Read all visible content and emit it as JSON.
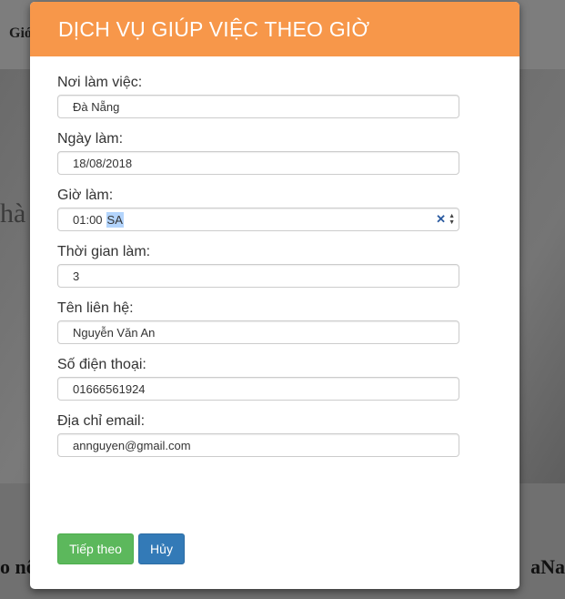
{
  "background": {
    "nav_text": "Giớ",
    "hero_text": "hà",
    "bottom_left": "o nổ",
    "bottom_right": "aNa"
  },
  "modal": {
    "title": "DỊCH VỤ GIÚP VIỆC THEO GIỜ",
    "fields": [
      {
        "label": "Nơi làm việc:",
        "value": "Đà Nẵng"
      },
      {
        "label": "Ngày làm:",
        "value": "18/08/2018"
      },
      {
        "label": "Giờ làm:",
        "value": "01:00",
        "suffix": "SA"
      },
      {
        "label": "Thời gian làm:",
        "value": "3"
      },
      {
        "label": "Tên liên hệ:",
        "value": "Nguyễn Văn An"
      },
      {
        "label": "Số điện thoại:",
        "value": "01666561924"
      },
      {
        "label": "Địa chỉ email:",
        "value": "annguyen@gmail.com"
      }
    ],
    "buttons": {
      "next": "Tiếp theo",
      "cancel": "Hủy"
    }
  },
  "colors": {
    "header": "#f7974a",
    "next_button": "#5cb85c",
    "cancel_button": "#337ab7"
  },
  "icons": {
    "clear": "close-icon",
    "spinner": "spinner-arrows-icon"
  }
}
